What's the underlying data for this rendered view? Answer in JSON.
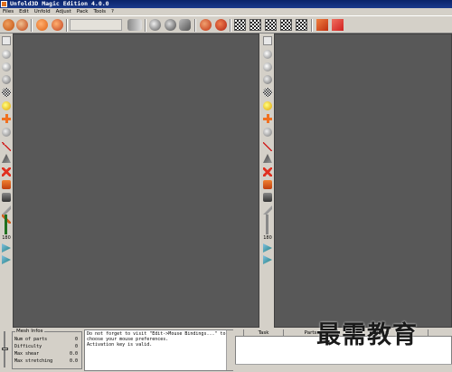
{
  "window": {
    "title": "Unfold3D Magic Edition 4.0.0"
  },
  "menu": {
    "items": [
      "Files",
      "Edit",
      "Unfold",
      "Adjust",
      "Pack",
      "Tools",
      "?"
    ]
  },
  "toolbar": {
    "icons": [
      "open-icon",
      "save-icon",
      "select-icon",
      "paint-icon",
      "blank-field",
      "cut-icon",
      "unfold-icon",
      "optimize-icon",
      "pins-icon",
      "sphere-icon",
      "checker-icon",
      "checker-2-icon",
      "checker-3-icon",
      "checker-4-icon",
      "layout-icon",
      "help-icon"
    ],
    "colors": {
      "orange": "#e07020",
      "red": "#c83020",
      "gray": "#a0a0a0"
    }
  },
  "left_sidebar": {
    "slider_value": "180"
  },
  "right_sidebar": {
    "slider_value": "180"
  },
  "mesh_info": {
    "title": "Mesh Infos",
    "rows": [
      {
        "label": "Num of parts",
        "value": "0"
      },
      {
        "label": "Difficulty",
        "value": "0"
      },
      {
        "label": "Max shear",
        "value": "0.0"
      },
      {
        "label": "Max stretching",
        "value": "0.0"
      }
    ]
  },
  "console": {
    "lines": [
      "Do not forget to visit \"Edit->Mouse Bindings...\" to",
      "choose your mouse preferences.",
      "Activation key is valid."
    ]
  },
  "table": {
    "columns": [
      "Task",
      "Parts",
      "Start"
    ]
  },
  "watermark": {
    "text": "最需教育"
  }
}
